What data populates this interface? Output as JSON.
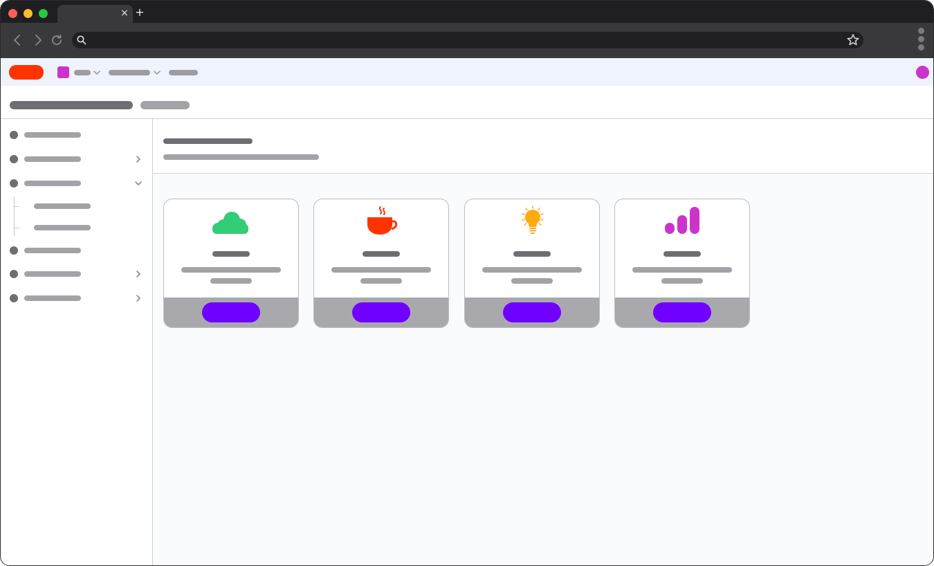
{
  "browser": {
    "tab": {
      "title": ""
    },
    "address_bar": {
      "value": ""
    },
    "icons": {
      "tab_close": "close-icon",
      "new_tab": "plus-icon",
      "back": "chevron-left-icon",
      "forward": "chevron-right-icon",
      "reload": "reload-icon",
      "search": "search-icon",
      "bookmark": "star-icon",
      "menu": "kebab-menu-icon"
    },
    "glyphs": {
      "close": "×",
      "plus": "+"
    }
  },
  "app": {
    "colors": {
      "brand": "#ff3300",
      "workspace": "#cc33cc",
      "avatar": "#cc33cc",
      "primary_button": "#7000ff",
      "header_bg": "#eff3fb"
    }
  },
  "sidebar": {
    "items": [
      {
        "expandable": false,
        "expanded": false
      },
      {
        "expandable": true,
        "expanded": false
      },
      {
        "expandable": true,
        "expanded": true,
        "children_count": 2
      },
      {
        "expandable": false,
        "expanded": false
      },
      {
        "expandable": true,
        "expanded": false
      },
      {
        "expandable": true,
        "expanded": false
      }
    ]
  },
  "cards": [
    {
      "icon": "cloud-icon",
      "icon_color": "#33cc77"
    },
    {
      "icon": "coffee-cup-icon",
      "icon_color": "#ff3300"
    },
    {
      "icon": "lightbulb-icon",
      "icon_color": "#ffaa11"
    },
    {
      "icon": "bar-chart-icon",
      "icon_color": "#cc33cc"
    }
  ]
}
